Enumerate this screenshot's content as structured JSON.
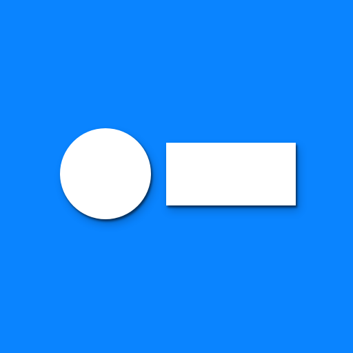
{
  "colors": {
    "background": "#0a84ff",
    "shape_fill": "#ffffff"
  },
  "shapes": [
    {
      "kind": "circle"
    },
    {
      "kind": "rectangle"
    }
  ]
}
